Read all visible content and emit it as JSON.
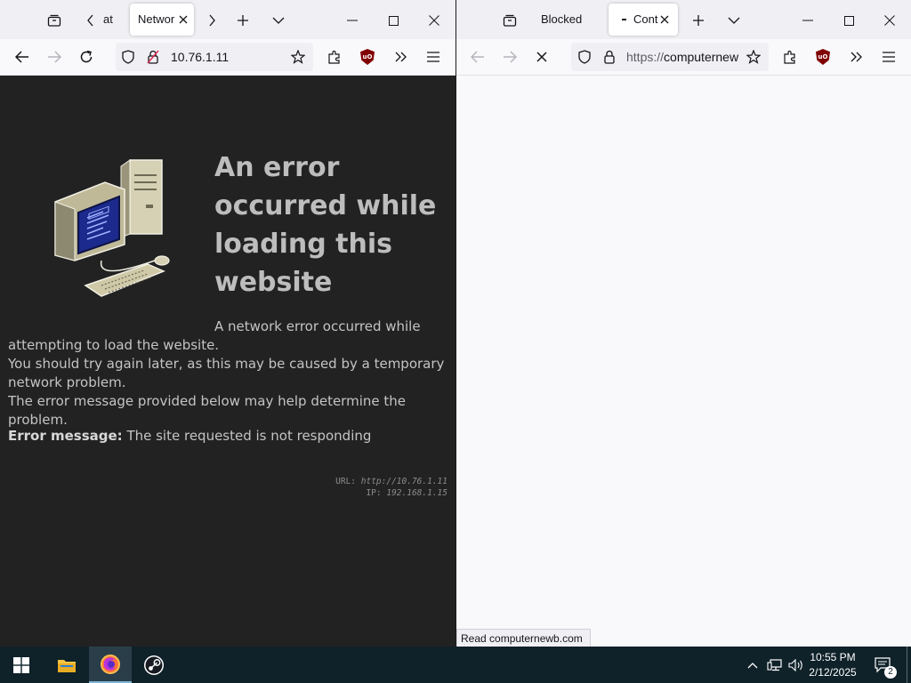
{
  "left_window": {
    "tabs": [
      {
        "label": "at"
      },
      {
        "label": "Networ",
        "active": true
      }
    ],
    "url": "10.76.1.11",
    "error_page": {
      "title": "An error occurred while loading this website",
      "paragraph_line1": "A network error occurred while",
      "paragraph_line2": "attempting to load the website.",
      "paragraph_line3": "You should try again later, as this may be caused by a temporary",
      "paragraph_line4": "network problem.",
      "paragraph_line5": "The error message provided below may help determine the problem.",
      "error_label": "Error message:",
      "error_text": "The site requested is not responding",
      "url_label": "URL:",
      "url_value": "http://10.76.1.11",
      "ip_label": "IP:",
      "ip_value": "192.168.1.15"
    }
  },
  "right_window": {
    "tabs": [
      {
        "label": "Blocked"
      },
      {
        "label": "Cont",
        "active": true,
        "loading": true
      }
    ],
    "url_scheme": "https://",
    "url_host": "computernew",
    "status_text": "Read computernewb.com"
  },
  "taskbar": {
    "apps": [
      "start",
      "file-explorer",
      "firefox",
      "steam"
    ],
    "time": "10:55 PM",
    "date": "2/12/2025",
    "notification_count": "2"
  },
  "colors": {
    "error_background": "#222222",
    "browser_chrome": "#f0f0f4",
    "taskbar": "#0f2129",
    "ublock_red": "#800000"
  }
}
